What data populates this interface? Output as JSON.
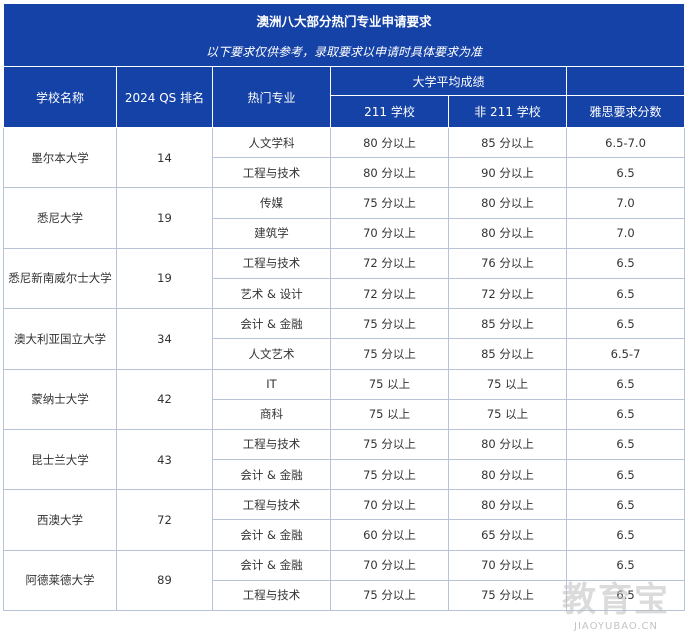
{
  "title": "澳洲八大部分热门专业申请要求",
  "note": "以下要求仅供参考，录取要求以申请时具体要求为准",
  "headers": {
    "school": "学校名称",
    "qs_rank": "2024 QS 排名",
    "major": "热门专业",
    "avg_group": "大学平均成绩",
    "school_211": "211 学校",
    "school_non211": "非 211 学校",
    "ielts": "雅思要求分数"
  },
  "universities": [
    {
      "name": "墨尔本大学",
      "rank": "14",
      "rows": [
        {
          "major": "人文学科",
          "s211": "80 分以上",
          "non211": "85 分以上",
          "ielts": "6.5-7.0"
        },
        {
          "major": "工程与技术",
          "s211": "80 分以上",
          "non211": "90 分以上",
          "ielts": "6.5"
        }
      ]
    },
    {
      "name": "悉尼大学",
      "rank": "19",
      "rows": [
        {
          "major": "传媒",
          "s211": "75 分以上",
          "non211": "80 分以上",
          "ielts": "7.0"
        },
        {
          "major": "建筑学",
          "s211": "70 分以上",
          "non211": "80 分以上",
          "ielts": "7.0"
        }
      ]
    },
    {
      "name": "悉尼新南威尔士大学",
      "rank": "19",
      "rows": [
        {
          "major": "工程与技术",
          "s211": "72 分以上",
          "non211": "76 分以上",
          "ielts": "6.5"
        },
        {
          "major": "艺术 & 设计",
          "s211": "72 分以上",
          "non211": "72 分以上",
          "ielts": "6.5"
        }
      ]
    },
    {
      "name": "澳大利亚国立大学",
      "rank": "34",
      "rows": [
        {
          "major": "会计 & 金融",
          "s211": "75 分以上",
          "non211": "85 分以上",
          "ielts": "6.5"
        },
        {
          "major": "人文艺术",
          "s211": "75 分以上",
          "non211": "85 分以上",
          "ielts": "6.5-7"
        }
      ]
    },
    {
      "name": "蒙纳士大学",
      "rank": "42",
      "rows": [
        {
          "major": "IT",
          "s211": "75 以上",
          "non211": "75 以上",
          "ielts": "6.5"
        },
        {
          "major": "商科",
          "s211": "75 以上",
          "non211": "75 以上",
          "ielts": "6.5"
        }
      ]
    },
    {
      "name": "昆士兰大学",
      "rank": "43",
      "rows": [
        {
          "major": "工程与技术",
          "s211": "75 分以上",
          "non211": "80 分以上",
          "ielts": "6.5"
        },
        {
          "major": "会计 & 金融",
          "s211": "75 分以上",
          "non211": "80 分以上",
          "ielts": "6.5"
        }
      ]
    },
    {
      "name": "西澳大学",
      "rank": "72",
      "rows": [
        {
          "major": "工程与技术",
          "s211": "70 分以上",
          "non211": "80 分以上",
          "ielts": "6.5"
        },
        {
          "major": "会计 & 金融",
          "s211": "60 分以上",
          "non211": "65 分以上",
          "ielts": "6.5"
        }
      ]
    },
    {
      "name": "阿德莱德大学",
      "rank": "89",
      "rows": [
        {
          "major": "会计 & 金融",
          "s211": "70 分以上",
          "non211": "70 分以上",
          "ielts": "6.5"
        },
        {
          "major": "工程与技术",
          "s211": "75 分以上",
          "non211": "75 分以上",
          "ielts": "6.5"
        }
      ]
    }
  ],
  "watermark": {
    "text_cn": "教育宝",
    "text_en": "JIAOYUBAO.CN"
  }
}
